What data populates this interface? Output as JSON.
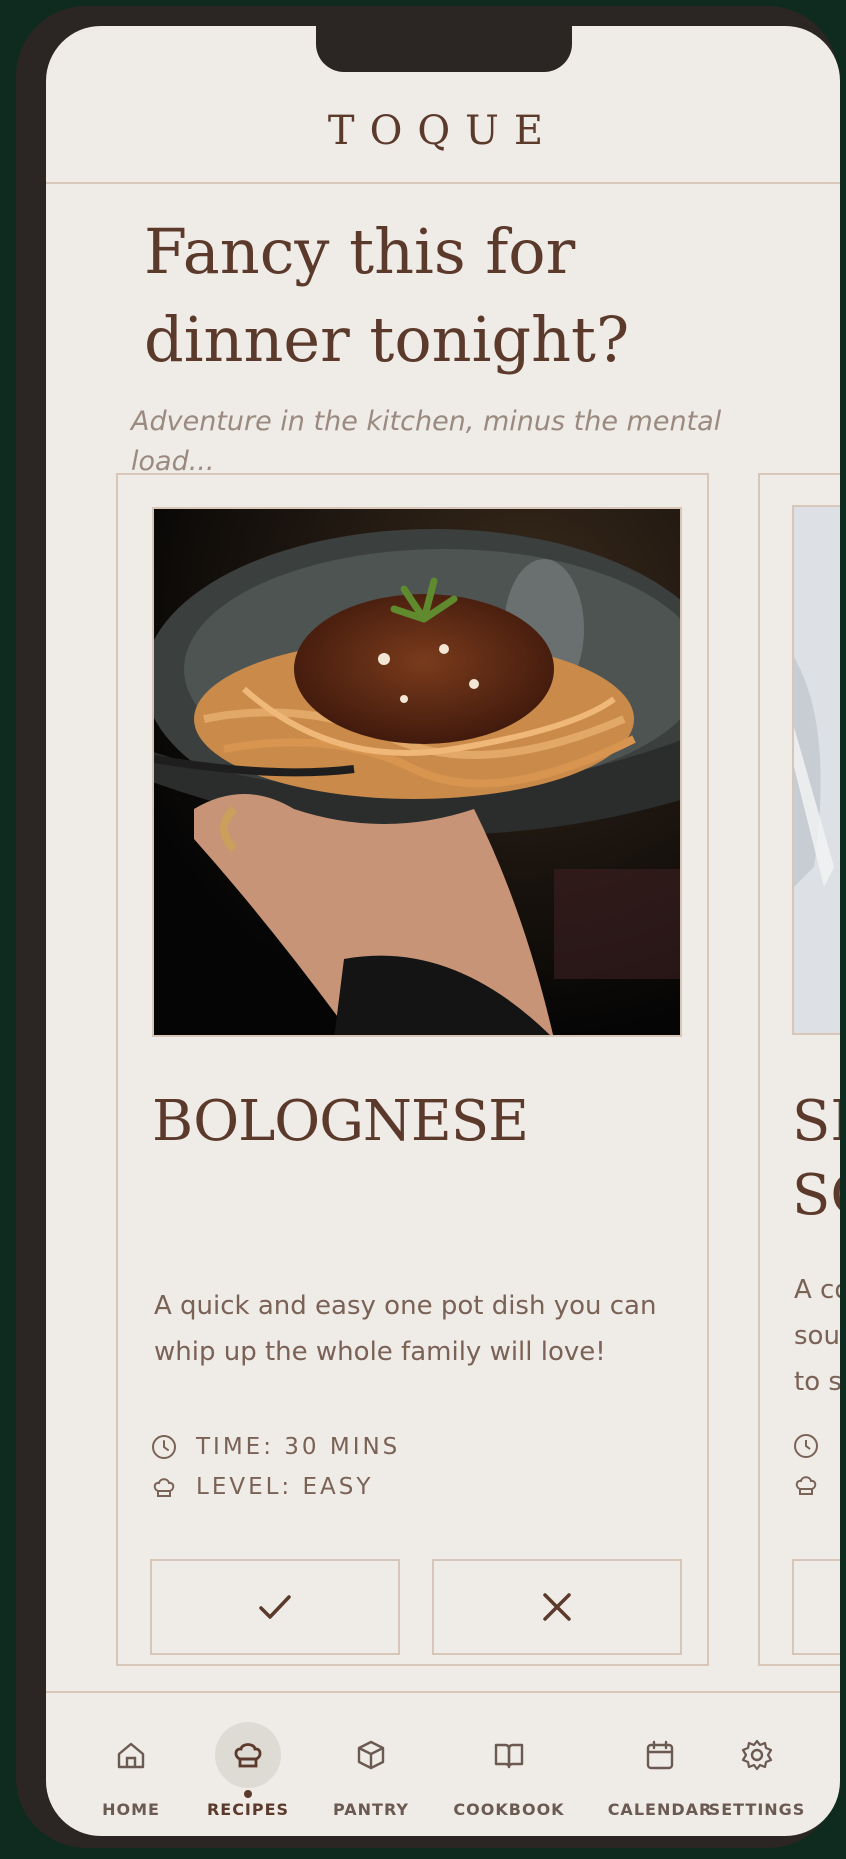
{
  "app": {
    "brand": "TOQUE"
  },
  "hero": {
    "title": "Fancy this for dinner tonight?",
    "subtitle": "Adventure in the kitchen, minus the mental load..."
  },
  "recipes": [
    {
      "title": "BOLOGNESE",
      "description": "A quick and easy one pot dish you can whip up the whole family will love!",
      "time_label": "TIME: 30 MINS",
      "level_label": "LEVEL: EASY",
      "image": "spaghetti-bolognese-bowl"
    },
    {
      "title_partial": "SE\nSQ",
      "description_partial": "A co\nsou\nto s"
    }
  ],
  "nav": {
    "items": [
      {
        "label": "HOME",
        "icon": "home-icon"
      },
      {
        "label": "RECIPES",
        "icon": "chef-hat-icon",
        "active": true
      },
      {
        "label": "PANTRY",
        "icon": "box-icon"
      },
      {
        "label": "COOKBOOK",
        "icon": "book-icon"
      },
      {
        "label": "CALENDAR",
        "icon": "calendar-icon"
      },
      {
        "label": "SETTINGS",
        "icon": "gear-icon"
      }
    ]
  },
  "colors": {
    "background": "#efebe6",
    "text_brown": "#5b3a2c",
    "border": "#d8c7b8",
    "frame": "#2b2624",
    "outside": "#0f2a1f"
  }
}
